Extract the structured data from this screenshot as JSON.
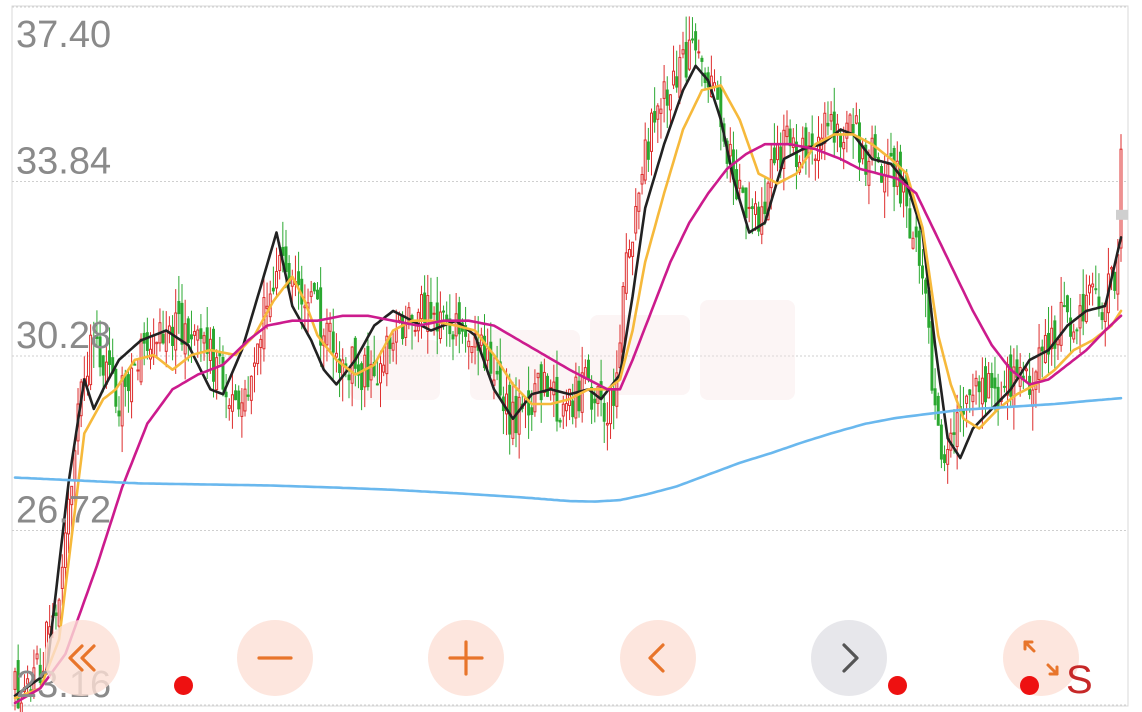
{
  "chart_data": {
    "type": "candlestick",
    "y_ticks": [
      "37.40",
      "33.84",
      "30.28",
      "26.72",
      "23.16"
    ],
    "ylim": [
      23.16,
      37.4
    ],
    "grid": true,
    "colors": {
      "up": "#dd2c2c",
      "down": "#2aa830",
      "ma_short": "#222222",
      "ma_mid": "#f6b93b",
      "ma_long": "#cc1b8d",
      "ma_xlong": "#6ab8ee",
      "price_marker": "#cfcfcf",
      "watermark": "#f7e2e2"
    },
    "ohlc_anchors": [
      [
        0,
        23.4
      ],
      [
        8,
        23.9
      ],
      [
        14,
        25.4
      ],
      [
        19,
        28.7
      ],
      [
        24,
        30.4
      ],
      [
        28,
        30.1
      ],
      [
        32,
        29.4
      ],
      [
        38,
        30.0
      ],
      [
        44,
        30.6
      ],
      [
        50,
        30.9
      ],
      [
        56,
        30.8
      ],
      [
        62,
        30.3
      ],
      [
        67,
        29.6
      ],
      [
        72,
        29.6
      ],
      [
        76,
        30.2
      ],
      [
        80,
        31.4
      ],
      [
        84,
        32.5
      ],
      [
        87,
        32.0
      ],
      [
        90,
        31.3
      ],
      [
        94,
        31.6
      ],
      [
        98,
        30.7
      ],
      [
        102,
        30.4
      ],
      [
        106,
        30.2
      ],
      [
        110,
        29.9
      ],
      [
        114,
        30.0
      ],
      [
        118,
        30.4
      ],
      [
        122,
        30.9
      ],
      [
        126,
        31.1
      ],
      [
        130,
        31.2
      ],
      [
        135,
        31.0
      ],
      [
        140,
        30.8
      ],
      [
        145,
        30.7
      ],
      [
        150,
        30.2
      ],
      [
        154,
        29.3
      ],
      [
        158,
        29.0
      ],
      [
        162,
        29.1
      ],
      [
        166,
        29.6
      ],
      [
        171,
        29.4
      ],
      [
        176,
        29.3
      ],
      [
        181,
        29.6
      ],
      [
        186,
        29.4
      ],
      [
        190,
        29.3
      ],
      [
        194,
        32.3
      ],
      [
        198,
        33.7
      ],
      [
        202,
        34.8
      ],
      [
        206,
        35.5
      ],
      [
        210,
        36.0
      ],
      [
        214,
        36.5
      ],
      [
        218,
        36.2
      ],
      [
        222,
        35.7
      ],
      [
        226,
        34.5
      ],
      [
        230,
        33.6
      ],
      [
        234,
        32.9
      ],
      [
        238,
        33.4
      ],
      [
        242,
        34.4
      ],
      [
        246,
        34.6
      ],
      [
        250,
        34.4
      ],
      [
        254,
        34.7
      ],
      [
        258,
        34.9
      ],
      [
        262,
        34.8
      ],
      [
        266,
        34.9
      ],
      [
        270,
        34.4
      ],
      [
        274,
        34.2
      ],
      [
        278,
        34.3
      ],
      [
        282,
        33.7
      ],
      [
        286,
        32.5
      ],
      [
        289,
        31.3
      ],
      [
        292,
        28.9
      ],
      [
        295,
        28.1
      ],
      [
        299,
        28.9
      ],
      [
        303,
        29.3
      ],
      [
        307,
        29.6
      ],
      [
        311,
        29.6
      ],
      [
        315,
        29.7
      ],
      [
        319,
        29.6
      ],
      [
        323,
        29.8
      ],
      [
        327,
        30.4
      ],
      [
        331,
        30.9
      ],
      [
        335,
        31.1
      ],
      [
        339,
        31.4
      ],
      [
        343,
        31.3
      ],
      [
        347,
        31.6
      ],
      [
        350,
        32.3
      ],
      [
        351,
        34.9
      ]
    ],
    "moving_averages": [
      {
        "color": "#222222",
        "values": [
          [
            0,
            23.35
          ],
          [
            10,
            23.8
          ],
          [
            17,
            27.7
          ],
          [
            22,
            29.8
          ],
          [
            25,
            29.2
          ],
          [
            28,
            29.6
          ],
          [
            33,
            30.2
          ],
          [
            40,
            30.6
          ],
          [
            48,
            30.8
          ],
          [
            55,
            30.5
          ],
          [
            62,
            29.6
          ],
          [
            66,
            29.5
          ],
          [
            72,
            30.4
          ],
          [
            78,
            31.7
          ],
          [
            83,
            32.8
          ],
          [
            88,
            31.3
          ],
          [
            94,
            30.6
          ],
          [
            98,
            30.0
          ],
          [
            102,
            29.7
          ],
          [
            108,
            30.2
          ],
          [
            114,
            30.9
          ],
          [
            120,
            31.2
          ],
          [
            126,
            31.0
          ],
          [
            132,
            30.8
          ],
          [
            140,
            31.0
          ],
          [
            146,
            30.7
          ],
          [
            152,
            29.6
          ],
          [
            158,
            29.0
          ],
          [
            164,
            29.5
          ],
          [
            170,
            29.6
          ],
          [
            176,
            29.5
          ],
          [
            182,
            29.6
          ],
          [
            186,
            29.4
          ],
          [
            192,
            29.9
          ],
          [
            196,
            31.5
          ],
          [
            200,
            33.3
          ],
          [
            206,
            34.6
          ],
          [
            212,
            35.7
          ],
          [
            216,
            36.2
          ],
          [
            220,
            35.9
          ],
          [
            224,
            35.1
          ],
          [
            228,
            33.9
          ],
          [
            233,
            32.8
          ],
          [
            238,
            33.0
          ],
          [
            244,
            34.3
          ],
          [
            250,
            34.5
          ],
          [
            256,
            34.6
          ],
          [
            262,
            34.9
          ],
          [
            266,
            34.8
          ],
          [
            272,
            34.3
          ],
          [
            278,
            34.2
          ],
          [
            283,
            33.8
          ],
          [
            288,
            32.8
          ],
          [
            292,
            30.5
          ],
          [
            296,
            28.6
          ],
          [
            300,
            28.2
          ],
          [
            304,
            28.8
          ],
          [
            310,
            29.2
          ],
          [
            316,
            29.6
          ],
          [
            322,
            30.2
          ],
          [
            328,
            30.4
          ],
          [
            334,
            30.9
          ],
          [
            340,
            31.2
          ],
          [
            346,
            31.3
          ],
          [
            351,
            32.7
          ]
        ]
      },
      {
        "color": "#f6b93b",
        "values": [
          [
            0,
            23.3
          ],
          [
            8,
            23.5
          ],
          [
            14,
            24.5
          ],
          [
            22,
            28.7
          ],
          [
            28,
            29.4
          ],
          [
            32,
            29.6
          ],
          [
            38,
            30.2
          ],
          [
            44,
            30.3
          ],
          [
            50,
            30.0
          ],
          [
            56,
            30.3
          ],
          [
            62,
            30.4
          ],
          [
            70,
            30.3
          ],
          [
            76,
            30.7
          ],
          [
            82,
            31.4
          ],
          [
            88,
            31.9
          ],
          [
            92,
            31.4
          ],
          [
            96,
            30.7
          ],
          [
            102,
            30.2
          ],
          [
            108,
            29.9
          ],
          [
            114,
            30.1
          ],
          [
            120,
            30.8
          ],
          [
            126,
            31.0
          ],
          [
            132,
            31.0
          ],
          [
            140,
            30.9
          ],
          [
            146,
            30.8
          ],
          [
            152,
            30.3
          ],
          [
            158,
            29.7
          ],
          [
            164,
            29.3
          ],
          [
            170,
            29.3
          ],
          [
            176,
            29.4
          ],
          [
            182,
            29.6
          ],
          [
            188,
            29.6
          ],
          [
            192,
            29.8
          ],
          [
            196,
            30.8
          ],
          [
            200,
            32.2
          ],
          [
            206,
            33.6
          ],
          [
            212,
            34.9
          ],
          [
            218,
            35.7
          ],
          [
            224,
            35.8
          ],
          [
            230,
            35.1
          ],
          [
            236,
            34.0
          ],
          [
            242,
            33.8
          ],
          [
            248,
            34.0
          ],
          [
            254,
            34.6
          ],
          [
            260,
            34.8
          ],
          [
            266,
            34.8
          ],
          [
            272,
            34.6
          ],
          [
            278,
            34.3
          ],
          [
            283,
            34.0
          ],
          [
            288,
            32.9
          ],
          [
            293,
            30.7
          ],
          [
            297,
            29.7
          ],
          [
            301,
            29.0
          ],
          [
            306,
            28.8
          ],
          [
            312,
            29.2
          ],
          [
            318,
            29.5
          ],
          [
            324,
            29.7
          ],
          [
            330,
            30.0
          ],
          [
            336,
            30.4
          ],
          [
            342,
            30.6
          ],
          [
            348,
            30.9
          ],
          [
            351,
            31.2
          ]
        ]
      },
      {
        "color": "#cc1b8d",
        "values": [
          [
            0,
            23.2
          ],
          [
            8,
            23.5
          ],
          [
            16,
            24.2
          ],
          [
            26,
            26.0
          ],
          [
            34,
            27.6
          ],
          [
            42,
            28.9
          ],
          [
            50,
            29.6
          ],
          [
            58,
            29.9
          ],
          [
            66,
            30.1
          ],
          [
            74,
            30.6
          ],
          [
            80,
            30.9
          ],
          [
            88,
            31.0
          ],
          [
            96,
            31.0
          ],
          [
            104,
            31.1
          ],
          [
            112,
            31.1
          ],
          [
            120,
            31.0
          ],
          [
            128,
            30.9
          ],
          [
            136,
            31.0
          ],
          [
            144,
            31.0
          ],
          [
            152,
            30.9
          ],
          [
            160,
            30.6
          ],
          [
            168,
            30.3
          ],
          [
            176,
            30.0
          ],
          [
            182,
            29.8
          ],
          [
            188,
            29.6
          ],
          [
            192,
            29.6
          ],
          [
            196,
            30.2
          ],
          [
            202,
            31.2
          ],
          [
            208,
            32.2
          ],
          [
            214,
            33.0
          ],
          [
            220,
            33.6
          ],
          [
            226,
            34.1
          ],
          [
            232,
            34.4
          ],
          [
            238,
            34.6
          ],
          [
            246,
            34.6
          ],
          [
            254,
            34.5
          ],
          [
            262,
            34.3
          ],
          [
            268,
            34.1
          ],
          [
            274,
            34.0
          ],
          [
            280,
            33.9
          ],
          [
            286,
            33.6
          ],
          [
            292,
            32.8
          ],
          [
            298,
            32.0
          ],
          [
            304,
            31.2
          ],
          [
            310,
            30.5
          ],
          [
            316,
            30.0
          ],
          [
            322,
            29.7
          ],
          [
            328,
            29.8
          ],
          [
            334,
            30.1
          ],
          [
            340,
            30.4
          ],
          [
            346,
            30.8
          ],
          [
            351,
            31.1
          ]
        ]
      },
      {
        "color": "#6ab8ee",
        "values": [
          [
            0,
            27.8
          ],
          [
            20,
            27.74
          ],
          [
            40,
            27.68
          ],
          [
            60,
            27.66
          ],
          [
            80,
            27.64
          ],
          [
            100,
            27.6
          ],
          [
            120,
            27.55
          ],
          [
            140,
            27.48
          ],
          [
            160,
            27.4
          ],
          [
            176,
            27.32
          ],
          [
            184,
            27.31
          ],
          [
            192,
            27.34
          ],
          [
            200,
            27.45
          ],
          [
            210,
            27.62
          ],
          [
            220,
            27.86
          ],
          [
            230,
            28.1
          ],
          [
            240,
            28.3
          ],
          [
            250,
            28.52
          ],
          [
            260,
            28.72
          ],
          [
            270,
            28.9
          ],
          [
            280,
            29.02
          ],
          [
            290,
            29.1
          ],
          [
            300,
            29.18
          ],
          [
            310,
            29.22
          ],
          [
            320,
            29.26
          ],
          [
            330,
            29.3
          ],
          [
            340,
            29.36
          ],
          [
            351,
            29.42
          ]
        ]
      }
    ]
  },
  "controls": {
    "items": [
      {
        "name": "fast-backward",
        "icon": "double-chevron-left-icon",
        "style": "peach"
      },
      {
        "name": "zoom-out",
        "icon": "minus-icon",
        "style": "peach"
      },
      {
        "name": "zoom-in",
        "icon": "plus-icon",
        "style": "peach"
      },
      {
        "name": "prev",
        "icon": "chevron-left-icon",
        "style": "peach"
      },
      {
        "name": "next",
        "icon": "chevron-right-icon",
        "style": "gray"
      },
      {
        "name": "fullscreen",
        "icon": "expand-arrows-icon",
        "style": "peach"
      }
    ],
    "s_label": "S"
  }
}
